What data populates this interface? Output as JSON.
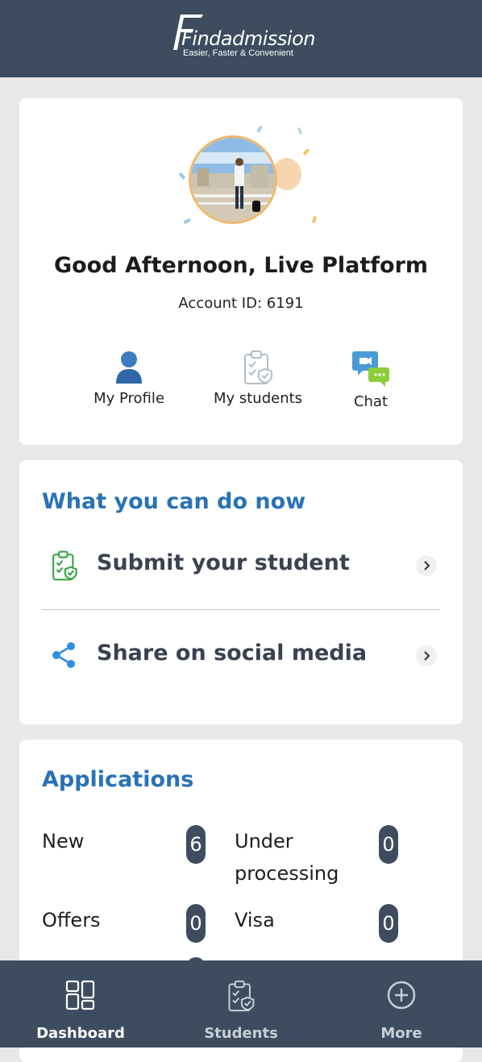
{
  "header": {
    "logo_text": "Findadmission",
    "tagline": "Easier, Faster & Convenient"
  },
  "profile": {
    "greeting": "Good Afternoon, Live Platform",
    "account_id": "Account ID: 6191",
    "actions": [
      {
        "label": "My Profile",
        "icon": "user-icon"
      },
      {
        "label": "My students",
        "icon": "clipboard-icon"
      },
      {
        "label": "Chat",
        "icon": "chat-bubbles-icon"
      }
    ]
  },
  "next_steps": {
    "title": "What you can do now",
    "items": [
      {
        "label": "Submit your student",
        "icon": "clipboard-shield-icon"
      },
      {
        "label": "Share on social media",
        "icon": "share-icon"
      }
    ]
  },
  "applications": {
    "title": "Applications",
    "stats": [
      {
        "label": "New",
        "count": "6"
      },
      {
        "label": "Under processing",
        "count": "0"
      },
      {
        "label": "Offers",
        "count": "0"
      },
      {
        "label": "Visa",
        "count": "0"
      }
    ]
  },
  "bottom_nav": [
    {
      "label": "Dashboard",
      "icon": "dashboard-icon",
      "active": true
    },
    {
      "label": "Students",
      "icon": "clipboard-icon",
      "active": false
    },
    {
      "label": "More",
      "icon": "plus-circle-icon",
      "active": false
    }
  ],
  "colors": {
    "header_bg": "#3d4c5e",
    "accent_blue": "#2a72b5",
    "badge_bg": "#3d4c5e",
    "active_nav": "#ffffff",
    "inactive_nav": "#c8ced6"
  }
}
